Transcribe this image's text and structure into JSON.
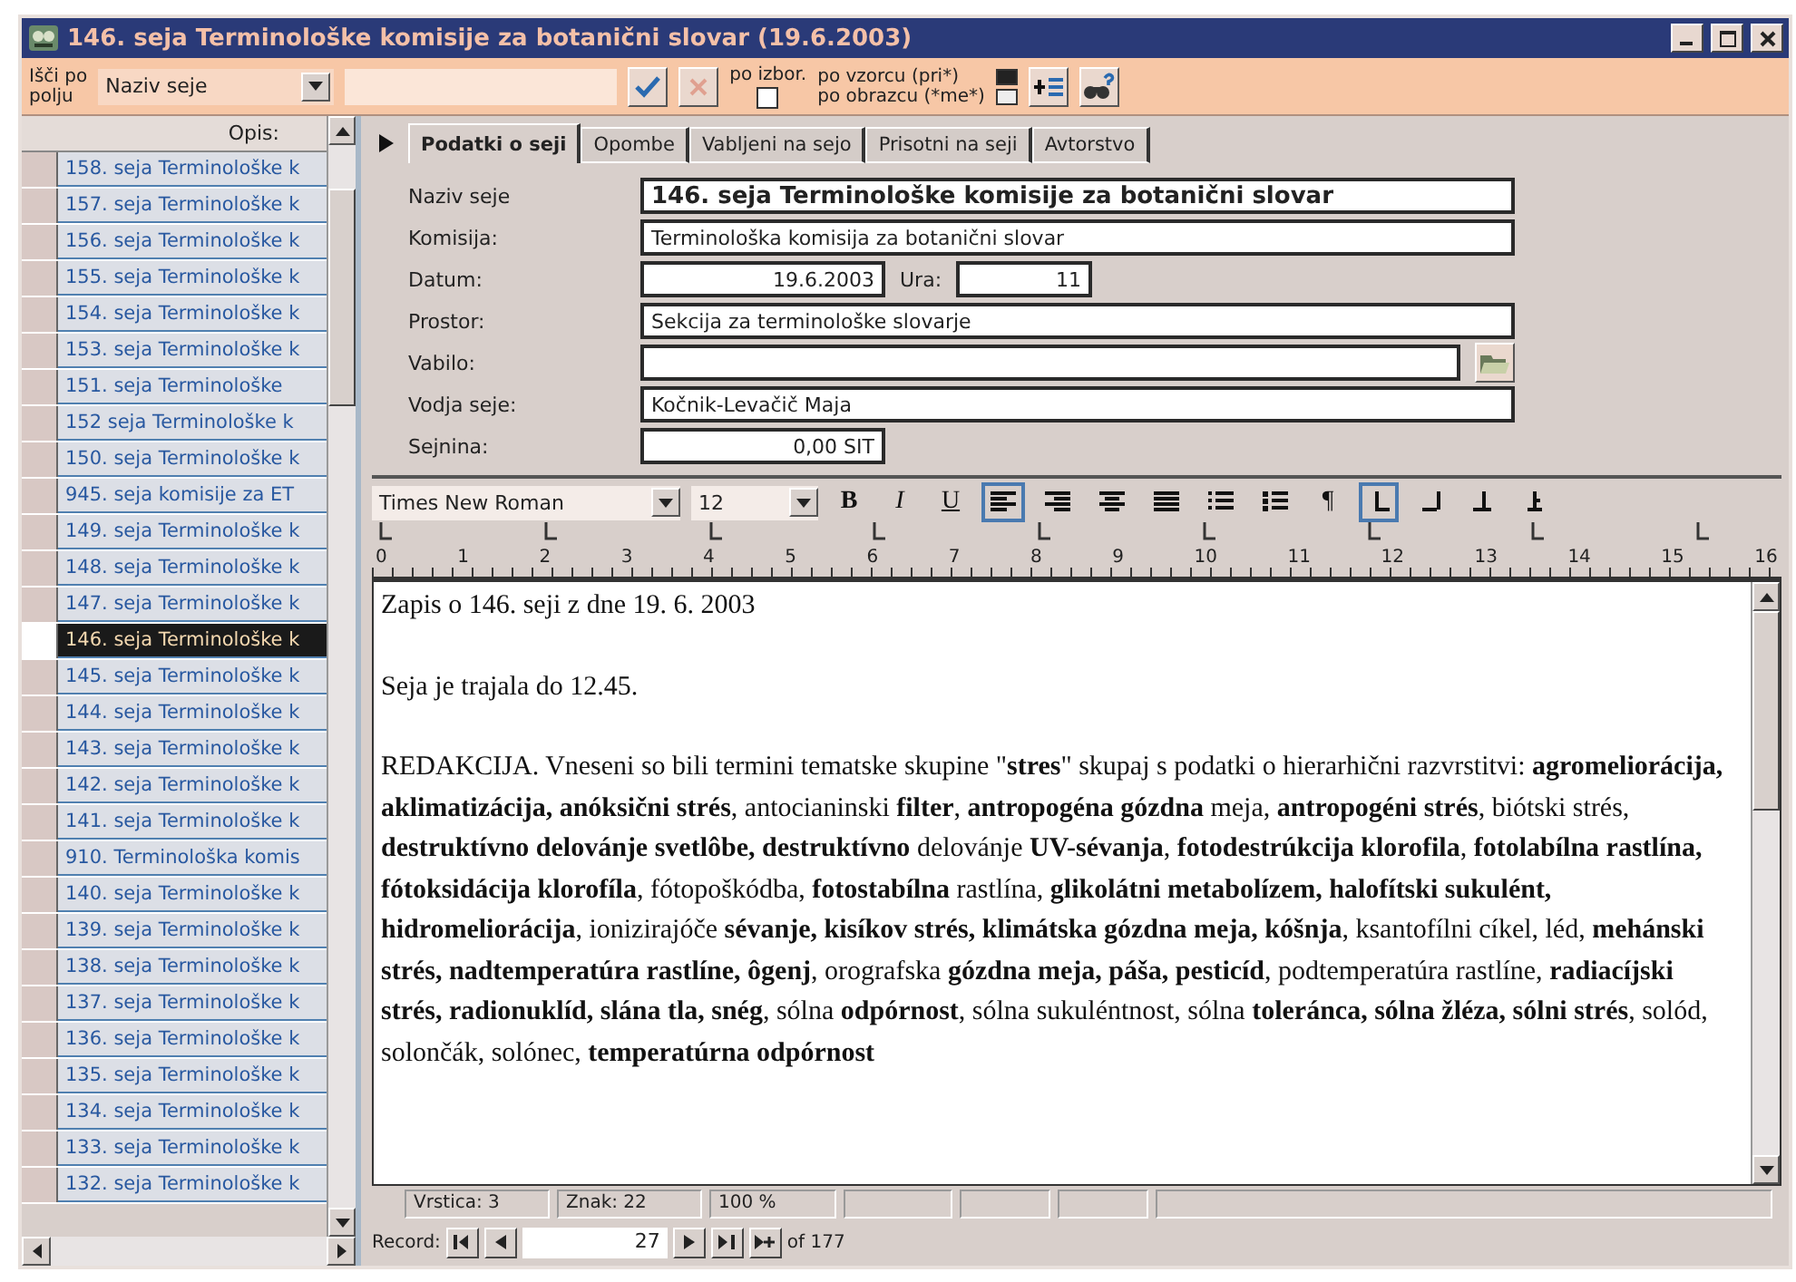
{
  "window": {
    "title": "146. seja Terminološke komisije za botanični slovar (19.6.2003)"
  },
  "search_bar": {
    "label_lines": [
      "Išči po",
      "polju"
    ],
    "field": "Naziv seje",
    "filter_checkbox": {
      "label": "po izbor.",
      "checked": false
    },
    "match_options": [
      {
        "label": "po vzorcu (pri*)",
        "selected": true
      },
      {
        "label": "po obrazcu (*me*)",
        "selected": false
      }
    ]
  },
  "list": {
    "header": "Opis:",
    "items": [
      {
        "label": "158. seja Terminološke k",
        "selected": false
      },
      {
        "label": "157. seja Terminološke k",
        "selected": false
      },
      {
        "label": "156. seja Terminološke k",
        "selected": false
      },
      {
        "label": "155. seja Terminološke k",
        "selected": false
      },
      {
        "label": "154. seja Terminološke k",
        "selected": false
      },
      {
        "label": "153. seja Terminološke k",
        "selected": false
      },
      {
        "label": "151. seja Terminološke",
        "selected": false
      },
      {
        "label": "152 seja Terminološke k",
        "selected": false
      },
      {
        "label": "150. seja Terminološke k",
        "selected": false
      },
      {
        "label": "945. seja komisije za ET",
        "selected": false
      },
      {
        "label": "149. seja Terminološke k",
        "selected": false
      },
      {
        "label": "148. seja Terminološke k",
        "selected": false
      },
      {
        "label": "147. seja Terminološke k",
        "selected": false
      },
      {
        "label": "146. seja Terminološke k",
        "selected": true
      },
      {
        "label": "145. seja Terminološke k",
        "selected": false
      },
      {
        "label": "144. seja Terminološke k",
        "selected": false
      },
      {
        "label": "143. seja Terminološke k",
        "selected": false
      },
      {
        "label": "142. seja Terminološke k",
        "selected": false
      },
      {
        "label": "141. seja Terminološke k",
        "selected": false
      },
      {
        "label": "910. Terminološka komis",
        "selected": false
      },
      {
        "label": "140. seja Terminološke k",
        "selected": false
      },
      {
        "label": "139. seja Terminološke k",
        "selected": false
      },
      {
        "label": "138. seja Terminološke k",
        "selected": false
      },
      {
        "label": "137. seja Terminološke k",
        "selected": false
      },
      {
        "label": "136. seja Terminološke k",
        "selected": false
      },
      {
        "label": "135. seja Terminološke k",
        "selected": false
      },
      {
        "label": "134. seja Terminološke k",
        "selected": false
      },
      {
        "label": "133. seja Terminološke k",
        "selected": false
      },
      {
        "label": "132. seja Terminološke k",
        "selected": false
      }
    ]
  },
  "tabs": [
    {
      "label": "Podatki o seji",
      "selected": true
    },
    {
      "label": "Opombe",
      "selected": false
    },
    {
      "label": "Vabljeni na sejo",
      "selected": false
    },
    {
      "label": "Prisotni na seji",
      "selected": false
    },
    {
      "label": "Avtorstvo",
      "selected": false
    }
  ],
  "form_rows": [
    {
      "fields": [
        {
          "label": "Naziv seje",
          "value": "146. seja Terminološke komisije za botanični slovar",
          "kind": "wide",
          "bold": true
        }
      ]
    },
    {
      "fields": [
        {
          "label": "Komisija:",
          "value": "Terminološka komisija za botanični slovar",
          "kind": "wide"
        }
      ]
    },
    {
      "fields": [
        {
          "label": "Datum:",
          "value": "19.6.2003",
          "kind": "number"
        },
        {
          "label": "Ura:",
          "value": "11",
          "kind": "small"
        }
      ]
    },
    {
      "fields": [
        {
          "label": "Prostor:",
          "value": "Sekcija za terminološke slovarje",
          "kind": "wide"
        }
      ]
    },
    {
      "fields": [
        {
          "label": "Vabilo:",
          "kind": "browse"
        }
      ]
    },
    {
      "fields": [
        {
          "label": "Vodja seje:",
          "value": "Kočnik-Levačič Maja",
          "kind": "wide"
        }
      ]
    },
    {
      "fields": [
        {
          "label": "Sejnina:",
          "value": "0,00 SIT",
          "kind": "number"
        }
      ]
    }
  ],
  "editor": {
    "font": "Times New Roman",
    "size": "12",
    "tools": [
      {
        "kind": "bold",
        "label": "B",
        "selected": false
      },
      {
        "kind": "italic",
        "label": "I",
        "selected": false
      },
      {
        "kind": "underline",
        "label": "U",
        "selected": false
      },
      {
        "kind": "align-left",
        "selected": true
      },
      {
        "kind": "align-right",
        "selected": false
      },
      {
        "kind": "align-center",
        "selected": false
      },
      {
        "kind": "justify",
        "selected": false
      },
      {
        "kind": "bullets",
        "selected": false
      },
      {
        "kind": "numbering",
        "selected": false
      },
      {
        "kind": "pilcrow",
        "label": "¶",
        "selected": false
      },
      {
        "kind": "tab-left",
        "selected": true
      },
      {
        "kind": "tab-right",
        "selected": false
      },
      {
        "kind": "tab-center",
        "selected": false
      },
      {
        "kind": "tab-decimal",
        "selected": false
      }
    ],
    "ruler": [
      "0",
      "1",
      "2",
      "3",
      "4",
      "5",
      "6",
      "7",
      "8",
      "9",
      "10",
      "11",
      "12",
      "13",
      "14",
      "15",
      "16"
    ],
    "paragraphs": [
      "Zapis o 146. seji z dne 19. 6. 2003",
      "Seja je trajala do 12.45.",
      "REDAKCIJA. Vneseni so bili termini tematske skupine \"**stres**\" skupaj s podatki o hierarhični razvrstitvi: **agromeliorácija, aklimatizácija, anóksični strés**, antocianinski **filter**, **antropogéna gózdna** meja, **antropogéni strés**, biótski strés, **destruktívno delovánje svetlôbe, destruktívno** delovánje **UV-sévanja**, **fotodestrúkcija klorofila**, **fotolabílna rastlína, fótoksidácija klorofíla**, fótopoškódba, **fotostabílna** rastlína, **glikolátni metabolízem, halofítski sukulént, hidromeliorácija**, ionizirajóče **sévanje, kisíkov strés, klimátska gózdna meja, kóšnja**, ksantofílni cíkel, léd, **mehánski strés, nadtemperatúra rastlíne, ôgenj**, orografska **gózdna meja, páša, pesticíd**, podtemperatúra rastlíne, **radiacíjski strés, radionuklíd, slána tla, snég**, sólna **odpórnost**, sólna sukuléntnost, sólna **toleránca, sólna žléza, sólni strés**, solód, solončák, solónec, **temperatúrna odpórnost**"
    ],
    "status": [
      "Vrstica: 3",
      "Znak: 22",
      "100 %"
    ]
  },
  "navigator": {
    "label": "Record:",
    "current": "27",
    "total": "of 177"
  }
}
